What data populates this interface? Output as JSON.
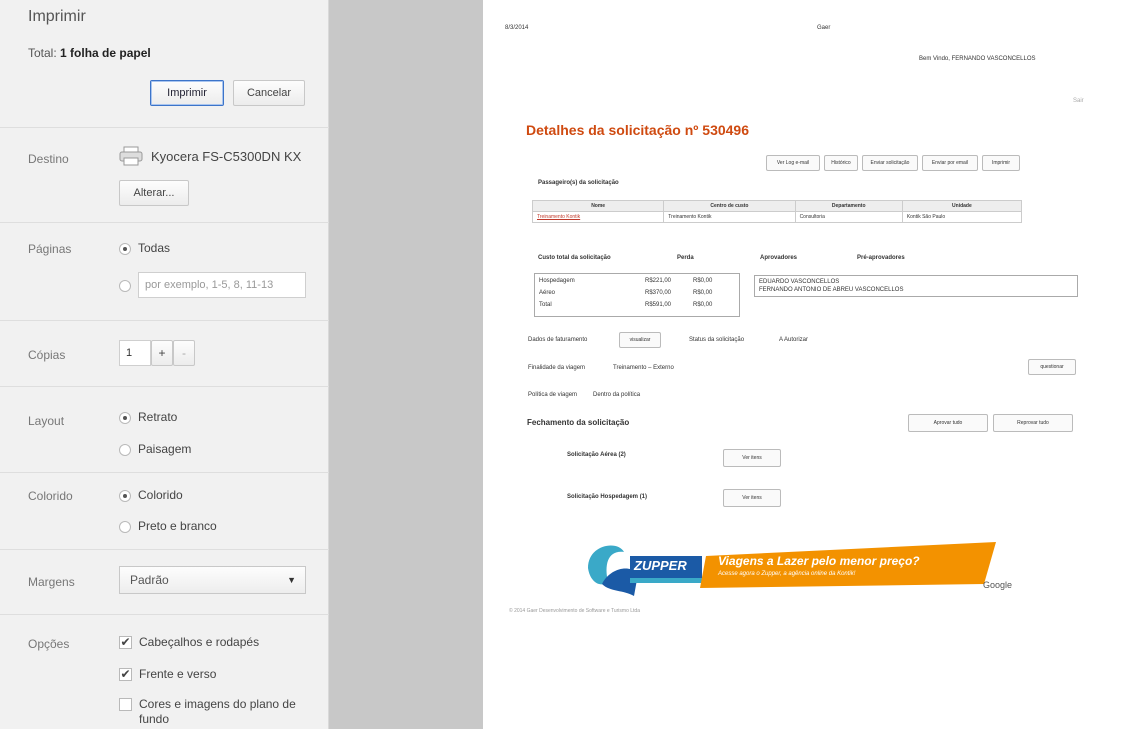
{
  "panel": {
    "heading": "Imprimir",
    "total_prefix": "Total:",
    "total_value": "1 folha de papel",
    "print_button": "Imprimir",
    "cancel_button": "Cancelar",
    "destination": {
      "label": "Destino",
      "printer": "Kyocera FS-C5300DN KX",
      "change_button": "Alterar..."
    },
    "pages": {
      "label": "Páginas",
      "all": "Todas",
      "range_placeholder": "por exemplo, 1-5, 8, 11-13"
    },
    "copies": {
      "label": "Cópias",
      "value": "1",
      "plus": "+",
      "minus": "-"
    },
    "layout": {
      "label": "Layout",
      "portrait": "Retrato",
      "landscape": "Paisagem"
    },
    "color": {
      "label": "Colorido",
      "color": "Colorido",
      "bw": "Preto e branco"
    },
    "margins": {
      "label": "Margens",
      "value": "Padrão"
    },
    "options": {
      "label": "Opções",
      "headers_footers": "Cabeçalhos e rodapés",
      "duplex": "Frente e verso",
      "backgrounds": "Cores e imagens do plano de fundo"
    }
  },
  "preview": {
    "header_left": "8/3/2014",
    "header_center": "Gaer",
    "welcome": "Bem Vindo, FERNANDO VASCONCELLOS",
    "top_right_link": "Sair",
    "title": "Detalhes da solicitação nº 530496",
    "actions": [
      "Ver Log e-mail",
      "Histórico",
      "Enviar solicitação",
      "Enviar por email",
      "Imprimir"
    ],
    "passengers_title": "Passageiro(s) da solicitação",
    "passenger_table": {
      "headers": [
        "Nome",
        "Centro de custo",
        "Departamento",
        "Unidade"
      ],
      "rows": [
        [
          "Treinamento Kontik",
          "Treinamento Kontik",
          "Consultoria",
          "Kontik São Paulo"
        ]
      ]
    },
    "cost_title": "Custo total da solicitação",
    "cost_headers": [
      "Perda",
      "Aprovadores",
      "Pré-aprovadores"
    ],
    "costs": [
      {
        "item": "Hospedagem",
        "value": "R$221,00",
        "loss": "R$0,00"
      },
      {
        "item": "Aéreo",
        "value": "R$370,00",
        "loss": "R$0,00"
      },
      {
        "item": "Total",
        "value": "R$591,00",
        "loss": "R$0,00"
      }
    ],
    "approvers": [
      "EDUARDO VASCONCELLOS",
      "FERNANDO ANTONIO DE ABREU VASCONCELLOS"
    ],
    "billing_label": "Dados de faturamento",
    "billing_button": "visualizar",
    "status_label": "Status da solicitação",
    "status_value": "A Autorizar",
    "purpose_label": "Finalidade da viagem",
    "purpose_value": "Treinamento – Externo",
    "questions_button": "questionar",
    "policy_label": "Política de viagem",
    "policy_value": "Dentro da política",
    "closing_title": "Fechamento da solicitação",
    "approve_all": "Aprovar tudo",
    "reject_all": "Reprovar tudo",
    "air_request": "Solicitação Aérea (2)",
    "hotel_request": "Solicitação Hospedagem (1)",
    "view_items": "Ver itens",
    "banner": {
      "brand": "ZUPPER",
      "headline": "Viagens a Lazer pelo menor preço?",
      "subline": "Acesse agora o Zupper, a agência online da Kontik!",
      "partner": "Google"
    },
    "footer": "© 2014 Gaer Desenvolvimento de Software e Turismo Ltda",
    "colors": {
      "accent": "#cf4a10",
      "banner_orange": "#f39200",
      "banner_blue": "#1b5aa6"
    }
  }
}
